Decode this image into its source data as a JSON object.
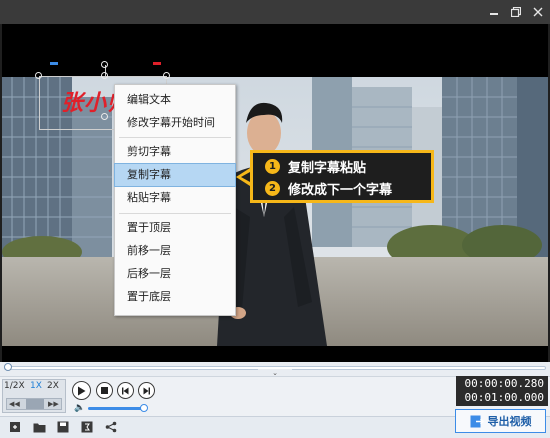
{
  "window": {
    "minimize_label": "",
    "maximize_icon": "restore-icon",
    "close_icon": "close-icon"
  },
  "video": {
    "subtitle_text": "张小帅"
  },
  "context_menu": {
    "items": [
      {
        "label": "编辑文本"
      },
      {
        "label": "修改字幕开始时间"
      },
      {
        "label": "剪切字幕"
      },
      {
        "label": "复制字幕"
      },
      {
        "label": "粘贴字幕"
      },
      {
        "label": "置于顶层"
      },
      {
        "label": "前移一层"
      },
      {
        "label": "后移一层"
      },
      {
        "label": "置于底层"
      }
    ],
    "selected": "复制字幕"
  },
  "callout": {
    "steps": [
      {
        "num": "1",
        "text": "复制字幕粘贴"
      },
      {
        "num": "2",
        "text": "修改成下一个字幕"
      }
    ],
    "accent": "#f6b719"
  },
  "playback": {
    "speeds": [
      "1/2X",
      "1X",
      "2X"
    ],
    "active_speed": "1X",
    "current_time": "00:00:00.280",
    "total_time": "00:01:00.000",
    "volume_level": 0.9,
    "progress": 0.01
  },
  "export": {
    "label": "导出视频"
  },
  "colors": {
    "accent": "#3c8ce7",
    "subtitle": "#e0202a",
    "menu_highlight": "#b6d7f3"
  }
}
